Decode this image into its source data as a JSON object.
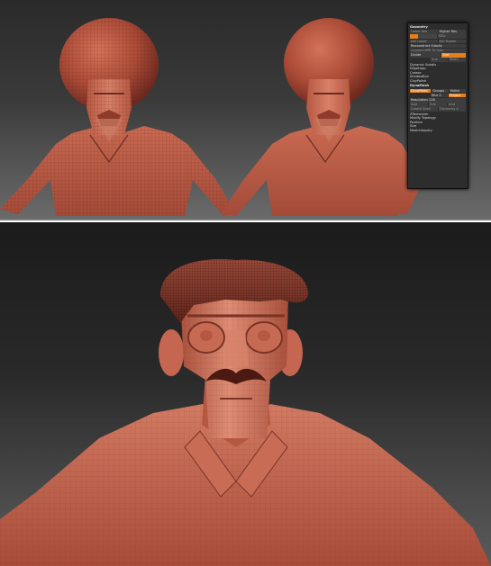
{
  "palette": {
    "title": "Geometry",
    "lower_res": "Lower Res",
    "higher_res": "Higher Res",
    "sdiv": "SDiv",
    "del_lower": "Del Lower",
    "del_higher": "Del Higher",
    "reconstruct_subdiv": "Reconstruct Subdiv",
    "convert_bpr": "Convert BPR To Geo",
    "divide": "Divide",
    "smt": "Smt",
    "suv": "Suv",
    "rel": "ReUV",
    "dynamic_subdiv": "Dynamic Subdiv",
    "edgeloop": "EdgeLoop",
    "crease": "Crease",
    "shadowbox": "ShadowBox",
    "claypolish": "ClayPolish",
    "dynamesh_header": "DynaMesh",
    "dynamesh": "DynaMesh",
    "groups": "Groups",
    "polish": "Polish",
    "blur": "Blur 2",
    "project": "Project",
    "resolution": "Resolution 128",
    "add": "Add",
    "sub": "Sub",
    "and": "And",
    "create_shell": "Create Shell",
    "thickness": "Thickness 4",
    "zremesher": "ZRemesher",
    "modify_topology": "Modify Topology",
    "position": "Position",
    "size": "Size",
    "meshintegrity": "MeshIntegrity"
  },
  "colors": {
    "clay": "#b85a45",
    "clay_dark": "#7a3326",
    "clay_light": "#d98670",
    "accent": "#e67e1a",
    "hair": "#7e3a2e"
  }
}
